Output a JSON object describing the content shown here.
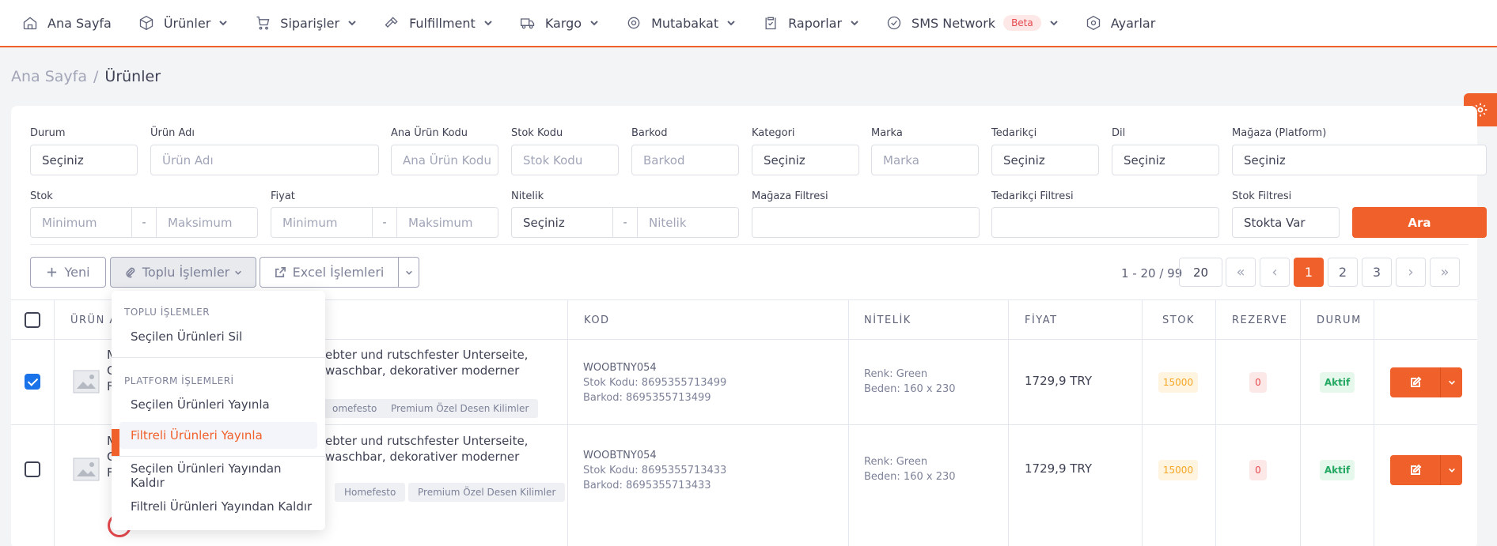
{
  "nav": [
    {
      "label": "Ana Sayfa",
      "icon": "home-icon",
      "chevron": false
    },
    {
      "label": "Ürünler",
      "icon": "box-icon",
      "chevron": true
    },
    {
      "label": "Siparişler",
      "icon": "cart-icon",
      "chevron": true
    },
    {
      "label": "Fulfillment",
      "icon": "hammer-icon",
      "chevron": true
    },
    {
      "label": "Kargo",
      "icon": "truck-icon",
      "chevron": true
    },
    {
      "label": "Mutabakat",
      "icon": "settings-icon",
      "chevron": true
    },
    {
      "label": "Raporlar",
      "icon": "clipboard-icon",
      "chevron": true
    },
    {
      "label": "SMS Network",
      "icon": "check-circle-icon",
      "chevron": true,
      "badge": "Beta"
    },
    {
      "label": "Ayarlar",
      "icon": "hexagon-icon",
      "chevron": false
    }
  ],
  "breadcrumb": {
    "home": "Ana Sayfa",
    "sep": "/",
    "current": "Ürünler"
  },
  "filters": {
    "durum": {
      "label": "Durum",
      "value": "Seçiniz"
    },
    "urun_adi": {
      "label": "Ürün Adı",
      "placeholder": "Ürün Adı"
    },
    "ana_urun_kodu": {
      "label": "Ana Ürün Kodu",
      "placeholder": "Ana Ürün Kodu"
    },
    "stok_kodu": {
      "label": "Stok Kodu",
      "placeholder": "Stok Kodu"
    },
    "barkod": {
      "label": "Barkod",
      "placeholder": "Barkod"
    },
    "kategori": {
      "label": "Kategori",
      "value": "Seçiniz"
    },
    "marka": {
      "label": "Marka",
      "placeholder": "Marka"
    },
    "tedarikci": {
      "label": "Tedarikçi",
      "value": "Seçiniz"
    },
    "dil": {
      "label": "Dil",
      "value": "Seçiniz"
    },
    "magaza": {
      "label": "Mağaza (Platform)",
      "value": "Seçiniz"
    },
    "stok": {
      "label": "Stok",
      "min": "Minimum",
      "max": "Maksimum"
    },
    "fiyat": {
      "label": "Fiyat",
      "min": "Minimum",
      "max": "Maksimum"
    },
    "nitelik": {
      "label": "Nitelik",
      "select": "Seçiniz",
      "input": "Nitelik"
    },
    "magaza_filtresi": {
      "label": "Mağaza Filtresi",
      "value": ""
    },
    "tedarikci_filtresi": {
      "label": "Tedarikçi Filtresi",
      "value": ""
    },
    "stok_filtresi": {
      "label": "Stok Filtresi",
      "value": "Stokta Var"
    },
    "dash": "-",
    "search_button": "Ara"
  },
  "toolbar": {
    "new_label": "Yeni",
    "bulk_label": "Toplu İşlemler",
    "excel_label": "Excel İşlemleri"
  },
  "pagination": {
    "range": "1 - 20 / 99",
    "page_size": "20",
    "first": "«",
    "prev": "‹",
    "pages": [
      "1",
      "2",
      "3"
    ],
    "current": "1",
    "next": "›",
    "last": "»"
  },
  "table": {
    "headers": {
      "urun": "ÜRÜN A",
      "kod": "KOD",
      "nitelik": "NİTELİK",
      "fiyat": "FİYAT",
      "stok": "STOK",
      "rezerve": "REZERVE",
      "durum": "DURUM"
    },
    "rows": [
      {
        "checked": true,
        "name_lines": [
          "M",
          "C",
          "F"
        ],
        "name_right": [
          "ebter und rutschfester Unterseite,",
          "waschbar, dekorativer moderner"
        ],
        "tags": [
          "omefesto",
          "Premium Özel Desen Kilimler"
        ],
        "kod": "WOOBTNY054",
        "stok_kodu": "Stok Kodu: 8695355713499",
        "barkod": "Barkod: 8695355713499",
        "renk": "Renk: Green",
        "beden": "Beden: 160 x 230",
        "fiyat": "1729,9 TRY",
        "stok": "15000",
        "rezerve": "0",
        "durum": "Aktif"
      },
      {
        "checked": false,
        "name_lines": [
          "M",
          "C",
          "F"
        ],
        "name_right": [
          "ebter und rutschfester Unterseite,",
          "waschbar, dekorativer moderner"
        ],
        "tags": [
          "Homefesto",
          "Premium Özel Desen Kilimler"
        ],
        "kod": "WOOBTNY054",
        "stok_kodu": "Stok Kodu: 8695355713433",
        "barkod": "Barkod: 8695355713433",
        "renk": "Renk: Green",
        "beden": "Beden: 160 x 230",
        "fiyat": "1729,9 TRY",
        "stok": "15000",
        "rezerve": "0",
        "durum": "Aktif"
      }
    ]
  },
  "menu": {
    "section1": "TOPLU İŞLEMLER",
    "delete_selected": "Seçilen Ürünleri Sil",
    "section2": "PLATFORM İŞLEMLERİ",
    "publish_selected": "Seçilen Ürünleri Yayınla",
    "publish_filtered": "Filtreli Ürünleri Yayınla",
    "unpublish_selected": "Seçilen Ürünleri Yayından Kaldır",
    "unpublish_filtered": "Filtreli Ürünleri Yayından Kaldır"
  },
  "colors": {
    "accent": "#f0602b",
    "checkbox": "#1a73e8",
    "stock": "#f5a623",
    "aktif": "#22a861",
    "rezerve": "#e5484d"
  }
}
